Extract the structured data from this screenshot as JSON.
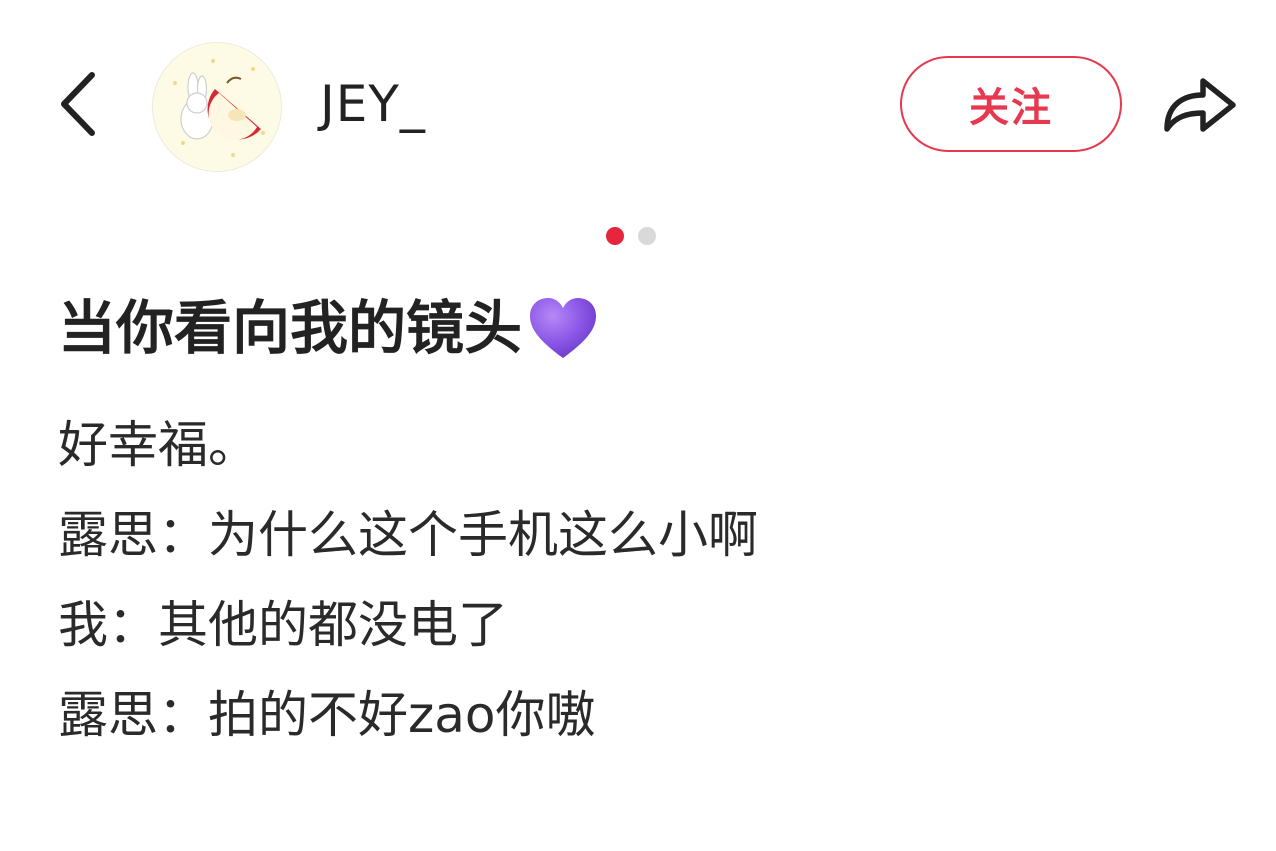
{
  "header": {
    "back_icon": "chevron-left-icon",
    "avatar_icon": "rabbit-apple-avatar",
    "username": "JEY_",
    "follow_label": "关注",
    "share_icon": "share-arrow-icon",
    "accent_color": "#e6394f"
  },
  "carousel": {
    "page_count": 2,
    "current_page": 1
  },
  "post": {
    "title": "当你看向我的镜头",
    "title_emoji": "purple-heart-emoji",
    "lines": [
      "好幸福。",
      "露思：为什么这个手机这么小啊",
      "我：其他的都没电了",
      "露思：拍的不好zao你嗷"
    ]
  }
}
